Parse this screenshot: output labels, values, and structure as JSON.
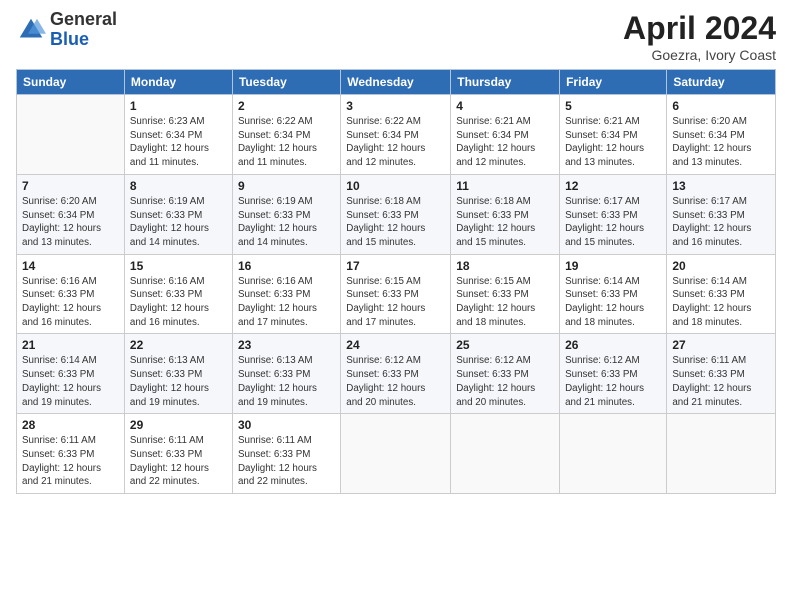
{
  "logo": {
    "general": "General",
    "blue": "Blue"
  },
  "title": "April 2024",
  "subtitle": "Goezra, Ivory Coast",
  "header_color": "#2e6db4",
  "days_of_week": [
    "Sunday",
    "Monday",
    "Tuesday",
    "Wednesday",
    "Thursday",
    "Friday",
    "Saturday"
  ],
  "weeks": [
    [
      {
        "num": "",
        "info": ""
      },
      {
        "num": "1",
        "info": "Sunrise: 6:23 AM\nSunset: 6:34 PM\nDaylight: 12 hours\nand 11 minutes."
      },
      {
        "num": "2",
        "info": "Sunrise: 6:22 AM\nSunset: 6:34 PM\nDaylight: 12 hours\nand 11 minutes."
      },
      {
        "num": "3",
        "info": "Sunrise: 6:22 AM\nSunset: 6:34 PM\nDaylight: 12 hours\nand 12 minutes."
      },
      {
        "num": "4",
        "info": "Sunrise: 6:21 AM\nSunset: 6:34 PM\nDaylight: 12 hours\nand 12 minutes."
      },
      {
        "num": "5",
        "info": "Sunrise: 6:21 AM\nSunset: 6:34 PM\nDaylight: 12 hours\nand 13 minutes."
      },
      {
        "num": "6",
        "info": "Sunrise: 6:20 AM\nSunset: 6:34 PM\nDaylight: 12 hours\nand 13 minutes."
      }
    ],
    [
      {
        "num": "7",
        "info": "Sunrise: 6:20 AM\nSunset: 6:34 PM\nDaylight: 12 hours\nand 13 minutes."
      },
      {
        "num": "8",
        "info": "Sunrise: 6:19 AM\nSunset: 6:33 PM\nDaylight: 12 hours\nand 14 minutes."
      },
      {
        "num": "9",
        "info": "Sunrise: 6:19 AM\nSunset: 6:33 PM\nDaylight: 12 hours\nand 14 minutes."
      },
      {
        "num": "10",
        "info": "Sunrise: 6:18 AM\nSunset: 6:33 PM\nDaylight: 12 hours\nand 15 minutes."
      },
      {
        "num": "11",
        "info": "Sunrise: 6:18 AM\nSunset: 6:33 PM\nDaylight: 12 hours\nand 15 minutes."
      },
      {
        "num": "12",
        "info": "Sunrise: 6:17 AM\nSunset: 6:33 PM\nDaylight: 12 hours\nand 15 minutes."
      },
      {
        "num": "13",
        "info": "Sunrise: 6:17 AM\nSunset: 6:33 PM\nDaylight: 12 hours\nand 16 minutes."
      }
    ],
    [
      {
        "num": "14",
        "info": "Sunrise: 6:16 AM\nSunset: 6:33 PM\nDaylight: 12 hours\nand 16 minutes."
      },
      {
        "num": "15",
        "info": "Sunrise: 6:16 AM\nSunset: 6:33 PM\nDaylight: 12 hours\nand 16 minutes."
      },
      {
        "num": "16",
        "info": "Sunrise: 6:16 AM\nSunset: 6:33 PM\nDaylight: 12 hours\nand 17 minutes."
      },
      {
        "num": "17",
        "info": "Sunrise: 6:15 AM\nSunset: 6:33 PM\nDaylight: 12 hours\nand 17 minutes."
      },
      {
        "num": "18",
        "info": "Sunrise: 6:15 AM\nSunset: 6:33 PM\nDaylight: 12 hours\nand 18 minutes."
      },
      {
        "num": "19",
        "info": "Sunrise: 6:14 AM\nSunset: 6:33 PM\nDaylight: 12 hours\nand 18 minutes."
      },
      {
        "num": "20",
        "info": "Sunrise: 6:14 AM\nSunset: 6:33 PM\nDaylight: 12 hours\nand 18 minutes."
      }
    ],
    [
      {
        "num": "21",
        "info": "Sunrise: 6:14 AM\nSunset: 6:33 PM\nDaylight: 12 hours\nand 19 minutes."
      },
      {
        "num": "22",
        "info": "Sunrise: 6:13 AM\nSunset: 6:33 PM\nDaylight: 12 hours\nand 19 minutes."
      },
      {
        "num": "23",
        "info": "Sunrise: 6:13 AM\nSunset: 6:33 PM\nDaylight: 12 hours\nand 19 minutes."
      },
      {
        "num": "24",
        "info": "Sunrise: 6:12 AM\nSunset: 6:33 PM\nDaylight: 12 hours\nand 20 minutes."
      },
      {
        "num": "25",
        "info": "Sunrise: 6:12 AM\nSunset: 6:33 PM\nDaylight: 12 hours\nand 20 minutes."
      },
      {
        "num": "26",
        "info": "Sunrise: 6:12 AM\nSunset: 6:33 PM\nDaylight: 12 hours\nand 21 minutes."
      },
      {
        "num": "27",
        "info": "Sunrise: 6:11 AM\nSunset: 6:33 PM\nDaylight: 12 hours\nand 21 minutes."
      }
    ],
    [
      {
        "num": "28",
        "info": "Sunrise: 6:11 AM\nSunset: 6:33 PM\nDaylight: 12 hours\nand 21 minutes."
      },
      {
        "num": "29",
        "info": "Sunrise: 6:11 AM\nSunset: 6:33 PM\nDaylight: 12 hours\nand 22 minutes."
      },
      {
        "num": "30",
        "info": "Sunrise: 6:11 AM\nSunset: 6:33 PM\nDaylight: 12 hours\nand 22 minutes."
      },
      {
        "num": "",
        "info": ""
      },
      {
        "num": "",
        "info": ""
      },
      {
        "num": "",
        "info": ""
      },
      {
        "num": "",
        "info": ""
      }
    ]
  ]
}
